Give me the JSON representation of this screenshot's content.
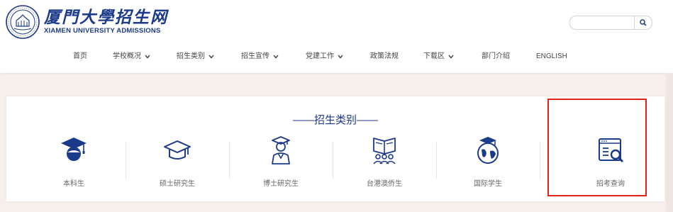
{
  "site": {
    "logo_cn": "厦門大學招生网",
    "logo_en": "XIAMEN UNIVERSITY ADMISSIONS"
  },
  "search": {
    "placeholder": ""
  },
  "nav": {
    "items": [
      {
        "label": "首页",
        "has_dropdown": false
      },
      {
        "label": "学校概况",
        "has_dropdown": true
      },
      {
        "label": "招生类别",
        "has_dropdown": true
      },
      {
        "label": "招生宣传",
        "has_dropdown": true
      },
      {
        "label": "党建工作",
        "has_dropdown": true
      },
      {
        "label": "政策法规",
        "has_dropdown": false
      },
      {
        "label": "下载区",
        "has_dropdown": true
      },
      {
        "label": "部门介绍",
        "has_dropdown": false
      },
      {
        "label": "ENGLISH",
        "has_dropdown": false
      }
    ]
  },
  "categories": {
    "title": "——招生类别——",
    "items": [
      {
        "label": "本科生",
        "icon": "bachelor-cap-icon"
      },
      {
        "label": "硕士研究生",
        "icon": "graduation-cap-icon"
      },
      {
        "label": "博士研究生",
        "icon": "doctor-graduate-icon"
      },
      {
        "label": "台港澳侨生",
        "icon": "students-reading-icon"
      },
      {
        "label": "国际学生",
        "icon": "globe-cap-icon"
      },
      {
        "label": "招考查询",
        "icon": "search-document-icon"
      }
    ]
  },
  "colors": {
    "brand": "#1c3a8a",
    "highlight": "#e32119"
  }
}
